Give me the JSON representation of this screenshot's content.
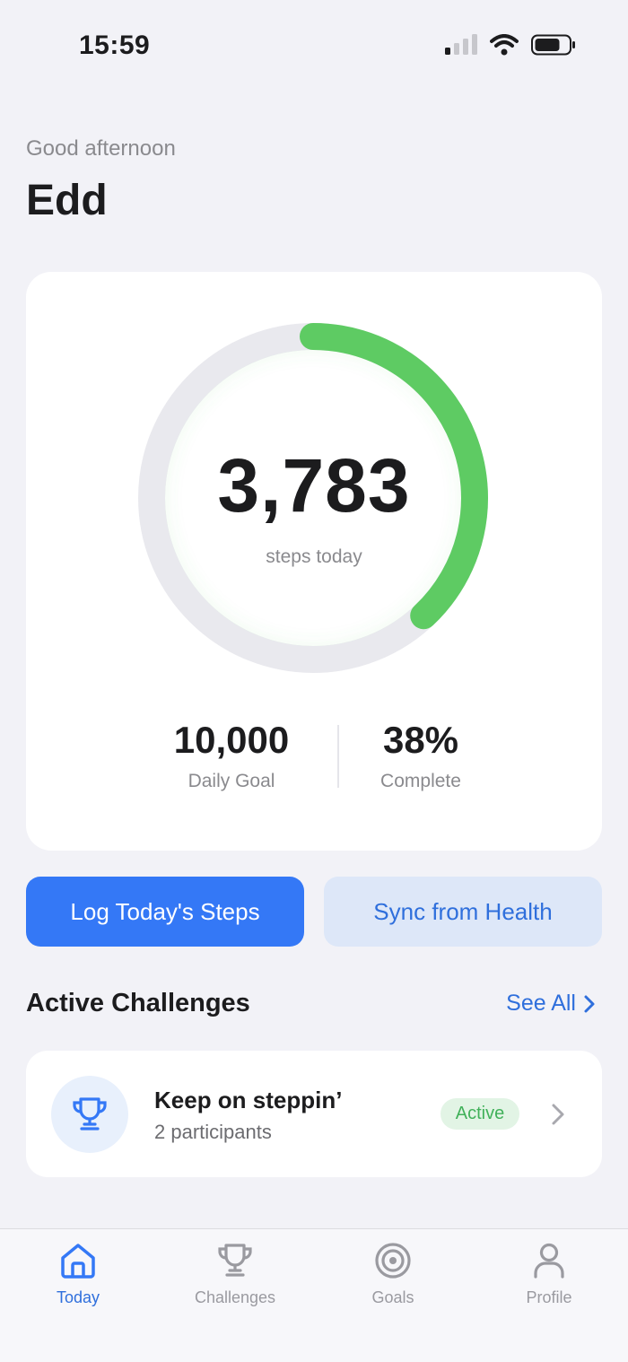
{
  "status_bar": {
    "time": "15:59"
  },
  "greeting": {
    "salutation": "Good afternoon",
    "name": "Edd"
  },
  "steps": {
    "count": "3,783",
    "caption": "steps today",
    "progress_fraction": 0.38,
    "goal_value": "10,000",
    "goal_label": "Daily Goal",
    "percent_value": "38%",
    "percent_label": "Complete"
  },
  "actions": {
    "log_label": "Log Today's Steps",
    "sync_label": "Sync from Health"
  },
  "challenges": {
    "title": "Active Challenges",
    "see_all_label": "See All",
    "items": [
      {
        "name": "Keep on steppin’",
        "participants": "2 participants",
        "status": "Active"
      }
    ]
  },
  "tabs": [
    {
      "label": "Today",
      "icon": "home-icon",
      "active": true
    },
    {
      "label": "Challenges",
      "icon": "trophy-icon",
      "active": false
    },
    {
      "label": "Goals",
      "icon": "target-icon",
      "active": false
    },
    {
      "label": "Profile",
      "icon": "person-icon",
      "active": false
    }
  ],
  "colors": {
    "accent": "#3478f6",
    "progress": "#5ecb63",
    "ring_track": "#e9e9ee",
    "badge_bg": "#e2f4e5",
    "badge_text": "#41b15a"
  }
}
